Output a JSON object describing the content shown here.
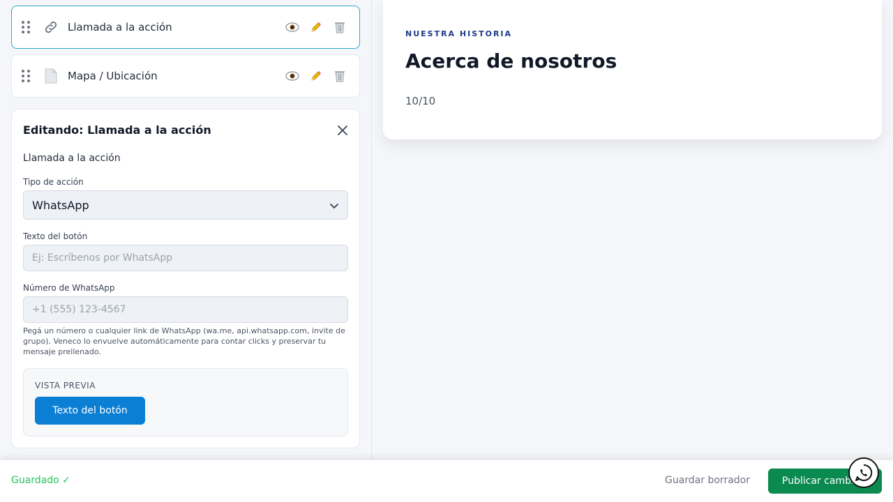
{
  "blocks": [
    {
      "label": "Llamada a la acción",
      "icon": "link-icon"
    },
    {
      "label": "Mapa / Ubicación",
      "icon": "document-icon"
    }
  ],
  "editor": {
    "title": "Editando: Llamada a la acción",
    "section_name": "Llamada a la acción",
    "action_type_label": "Tipo de acción",
    "action_type_value": "WhatsApp",
    "button_text_label": "Texto del botón",
    "button_text_placeholder": "Ej: Escríbenos por WhatsApp",
    "whatsapp_label": "Número de WhatsApp",
    "whatsapp_placeholder": "+1 (555) 123-4567",
    "help_text": "Pegá un número o cualquier link de WhatsApp (wa.me, api.whatsapp.com, invite de grupo). Veneco lo envuelve automáticamente para contar clicks y preservar tu mensaje prellenado.",
    "preview_label": "VISTA PREVIA",
    "preview_button": "Texto del botón"
  },
  "preview": {
    "eyebrow": "NUESTRA HISTORIA",
    "title": "Acerca de nosotros",
    "counter": "10/10"
  },
  "footer": {
    "status": "Guardado ✓",
    "draft_button": "Guardar borrador",
    "publish_button": "Publicar cambios"
  },
  "colors": {
    "accent": "#0a7fd4",
    "publish": "#0b8a4f",
    "saved": "#22c55e",
    "active_border": "#2aa7c9"
  }
}
